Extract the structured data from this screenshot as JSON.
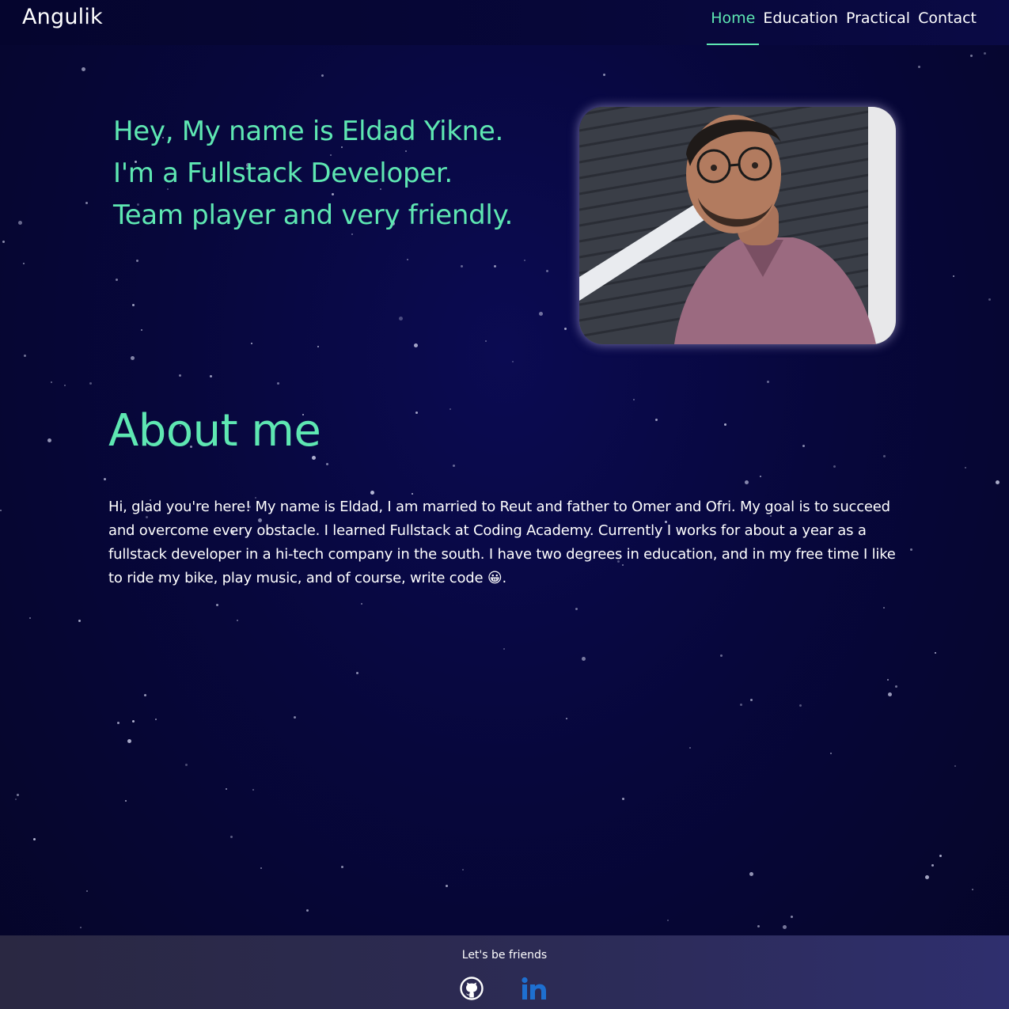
{
  "header": {
    "brand": "Angulik",
    "nav": [
      {
        "label": "Home",
        "active": true
      },
      {
        "label": "Education",
        "active": false
      },
      {
        "label": "Practical",
        "active": false
      },
      {
        "label": "Contact",
        "active": false
      }
    ]
  },
  "hero": {
    "lines": [
      "Hey, My name is Eldad Yikne.",
      "I'm a Fullstack Developer.",
      "Team player and very friendly."
    ]
  },
  "about": {
    "title": "About me",
    "text": "Hi, glad you're here! My name is Eldad, I am married to Reut and father to Omer and Ofri. My goal is to succeed and overcome every obstacle. I learned Fullstack at Coding Academy. Currently I works for about a year as a fullstack developer in a hi-tech company in the south. I have two degrees in education, and in my free time I like to ride my bike, play music, and of course, write code 😀."
  },
  "footer": {
    "title": "Let's be friends",
    "links": [
      {
        "icon": "github-icon"
      },
      {
        "icon": "linkedin-icon"
      }
    ]
  },
  "colors": {
    "accent": "#5ee7b2",
    "background": "#07073c",
    "footer": "#2c2b55",
    "linkedin": "#1e6fd0"
  }
}
